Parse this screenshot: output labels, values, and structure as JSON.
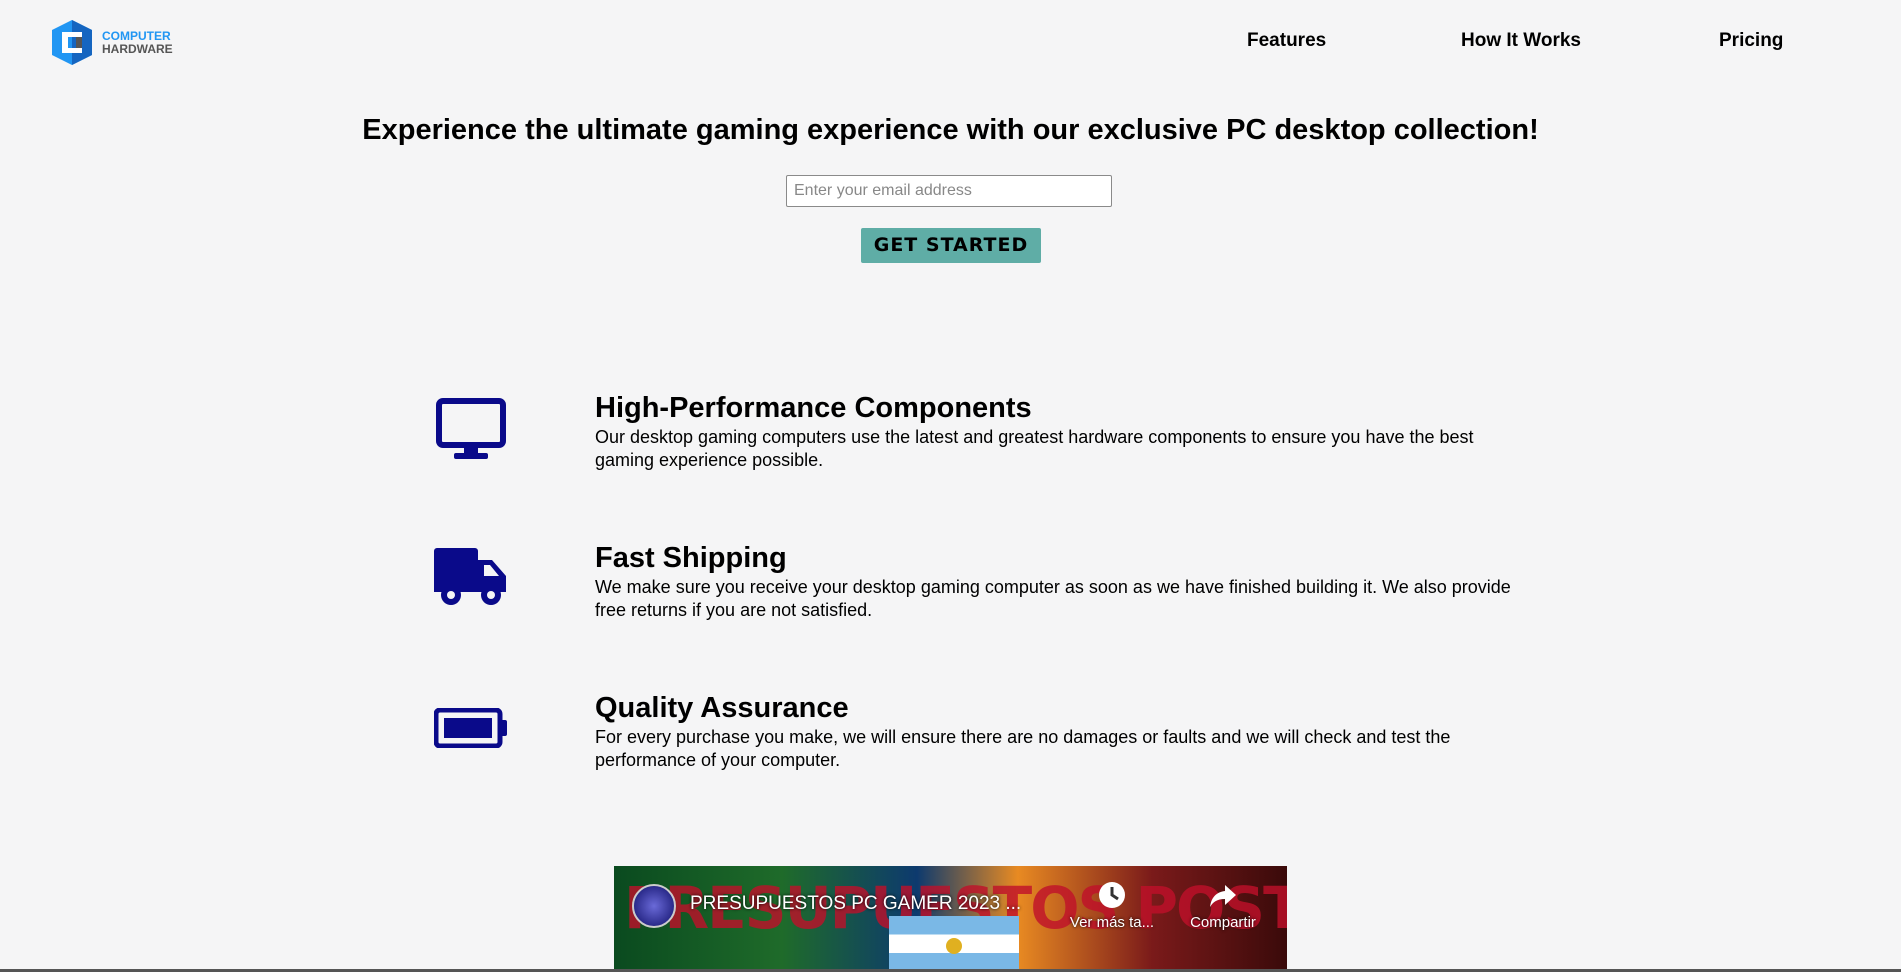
{
  "logo": {
    "line1": "COMPUTER",
    "line2": "HARDWARE",
    "colors": {
      "blue": "#2196f3",
      "gray": "#555555"
    }
  },
  "nav": {
    "items": [
      {
        "label": "Features"
      },
      {
        "label": "How It Works"
      },
      {
        "label": "Pricing"
      }
    ]
  },
  "hero": {
    "title": "Experience the ultimate gaming experience with our exclusive PC desktop collection!",
    "email_placeholder": "Enter your email address",
    "cta_label": "GET STARTED",
    "cta_color": "#5fada6"
  },
  "features": [
    {
      "icon": "desktop-monitor-icon",
      "title": "High-Performance Components",
      "text": "Our desktop gaming computers use the latest and greatest hardware components to ensure you have the best gaming experience possible."
    },
    {
      "icon": "shipping-truck-icon",
      "title": "Fast Shipping",
      "text": "We make sure you receive your desktop gaming computer as soon as we have finished building it. We also provide free returns if you are not satisfied."
    },
    {
      "icon": "battery-full-icon",
      "title": "Quality Assurance",
      "text": "For every purchase you make, we will ensure there are no damages or faults and we will check and test the performance of your computer."
    }
  ],
  "icon_color": "#0a0a8a",
  "video": {
    "title": "PRESUPUESTOS PC GAMER 2023 ...",
    "thumbnail_text": "PRESUPUESTOS POST ELECCIONES",
    "watch_later_label": "Ver más ta...",
    "share_label": "Compartir"
  }
}
